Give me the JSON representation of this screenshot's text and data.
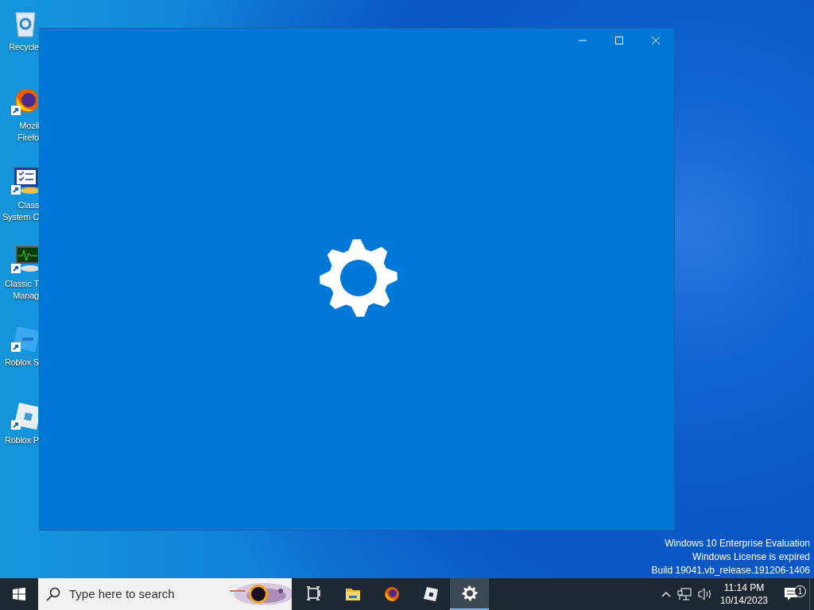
{
  "desktop": {
    "icons": [
      {
        "kind": "recycle",
        "label": "Recycle",
        "shortcut": false
      },
      {
        "kind": "firefox",
        "label": "Mozil\nFirefo",
        "shortcut": true
      },
      {
        "kind": "sysconfig",
        "label": "Class\nSystem C",
        "shortcut": true
      },
      {
        "kind": "taskmgr",
        "label": "Classic T\nManag",
        "shortcut": true
      },
      {
        "kind": "studio",
        "label": "Roblox S",
        "shortcut": true
      },
      {
        "kind": "player",
        "label": "Roblox P",
        "shortcut": true
      }
    ],
    "system_notice": [
      "Windows 10 Enterprise Evaluation",
      "Windows License is expired",
      "Build 19041.vb_release.191206-1406"
    ]
  },
  "taskbar": {
    "search": {
      "placeholder": "Type here to search"
    },
    "apps": [
      {
        "kind": "taskview",
        "selected": false
      },
      {
        "kind": "explorer",
        "selected": false
      },
      {
        "kind": "firefox",
        "selected": false
      },
      {
        "kind": "player",
        "selected": false
      },
      {
        "kind": "settings",
        "selected": true
      }
    ],
    "clock": {
      "time": "11:14 PM",
      "date": "10/14/2023"
    },
    "notifications": {
      "count": "1"
    }
  }
}
